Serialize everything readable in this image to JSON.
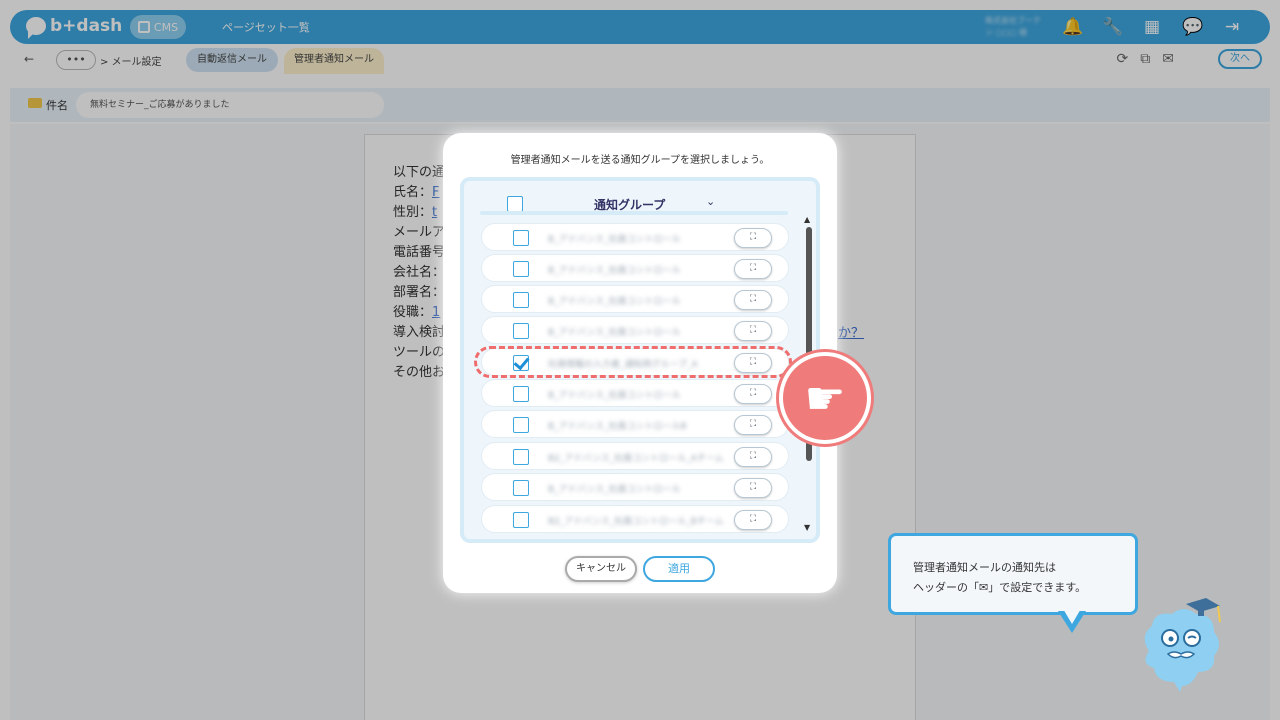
{
  "app": {
    "brand": "b+dash",
    "cms_label": "CMS",
    "nav_link": "ページセット一覧",
    "user_text": "株式会社ブーテン ○○○ 様"
  },
  "subbar": {
    "back": "←",
    "more": "•••",
    "crumb": "> メール設定",
    "tab_auto": "自動返信メール",
    "tab_admin": "管理者通知メール",
    "next": "次へ"
  },
  "subject": {
    "label": "件名",
    "value": "無料セミナー_ご応募がありました"
  },
  "body": {
    "lines": [
      "以下の通",
      "氏名：",
      "性別：",
      "メールア",
      "電話番号",
      "会社名：",
      "部署名：",
      "役職：",
      "導入検討",
      "ツールの",
      "その他お"
    ],
    "link_right": "か？"
  },
  "modal": {
    "title": "管理者通知メールを送る通知グループを選択しましょう。",
    "header_label": "通知グループ",
    "rows": [
      {
        "label": "B_アドバンス_社員コントロール",
        "checked": false
      },
      {
        "label": "B_アドバンス_社員コントロール",
        "checked": false
      },
      {
        "label": "B_アドバンス_社員コントロール",
        "checked": false
      },
      {
        "label": "B_アドバンス_社員コントロール",
        "checked": false
      },
      {
        "label": "社員情報の入力者_通知用グループ_A",
        "checked": true
      },
      {
        "label": "B_アドバンス_社員コントロール",
        "checked": false
      },
      {
        "label": "B_アドバンス_社員コントロールB",
        "checked": false
      },
      {
        "label": "B2_アドバンス_社員コントロール_Aチーム",
        "checked": false
      },
      {
        "label": "B_アドバンス_社員コントロール",
        "checked": false
      },
      {
        "label": "B2_アドバンス_社員コントロール_Bチーム",
        "checked": false
      }
    ],
    "expand_label": "⛶",
    "cancel": "キャンセル",
    "apply": "適用"
  },
  "tooltip": {
    "line1": "管理者通知メールの通知先は",
    "line2": "ヘッダーの「✉」で設定できます。"
  },
  "colors": {
    "accent": "#3ea7e0",
    "highlight": "#ef6d6d"
  }
}
